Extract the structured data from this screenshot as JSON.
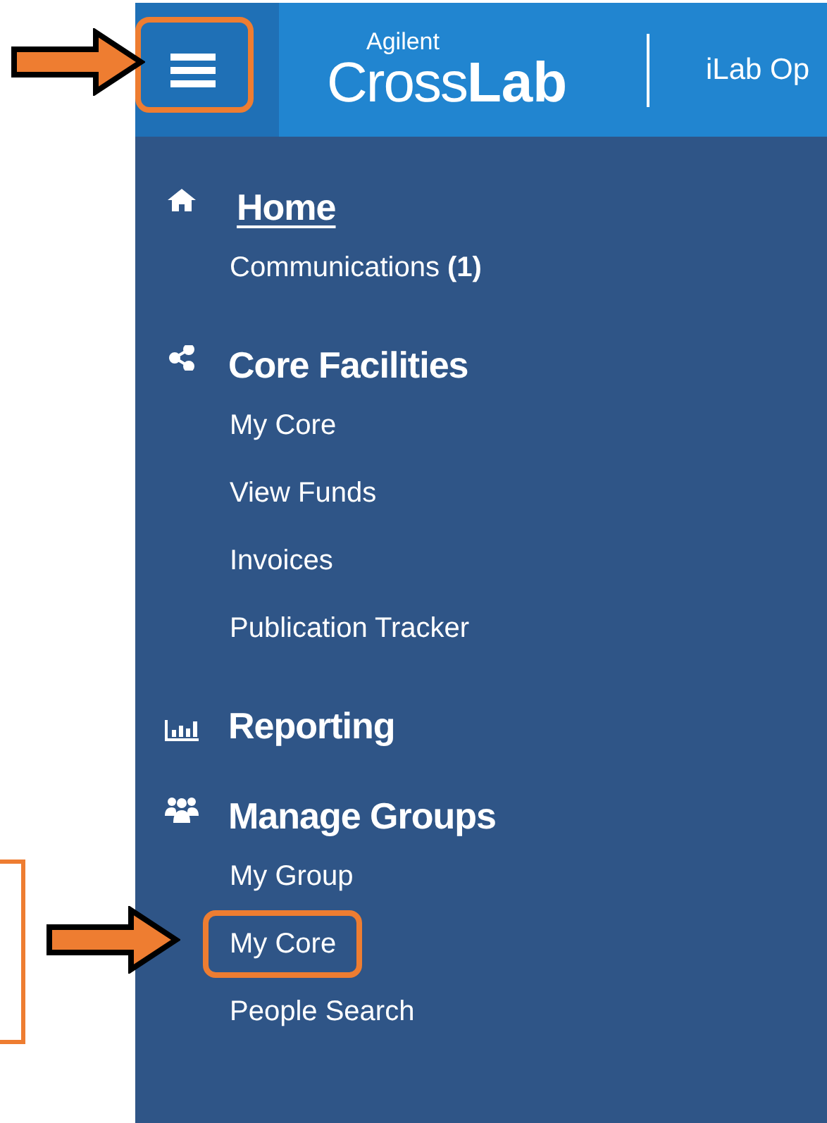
{
  "header": {
    "menu_button": {
      "highlighted": true
    },
    "logo": {
      "top": "Agilent",
      "left": "Cross",
      "right": "Lab"
    },
    "app_title": "iLab Op"
  },
  "sections": [
    {
      "title": "Home",
      "selected": true,
      "items": [
        {
          "label": "Communications **(1)**",
          "highlighted": false
        }
      ]
    },
    {
      "title": "Core Facilities",
      "selected": false,
      "items": [
        {
          "label": "My Core",
          "highlighted": false
        },
        {
          "label": "View Funds",
          "highlighted": false
        },
        {
          "label": "Invoices",
          "highlighted": false
        },
        {
          "label": "Publication Tracker",
          "highlighted": false
        }
      ]
    },
    {
      "title": "Reporting",
      "selected": false
    },
    {
      "title": "Manage Groups",
      "selected": false,
      "items": [
        {
          "label": "My Group",
          "highlighted": false
        },
        {
          "label": "My Core",
          "highlighted": true
        },
        {
          "label": "People Search",
          "highlighted": false
        }
      ]
    }
  ]
}
